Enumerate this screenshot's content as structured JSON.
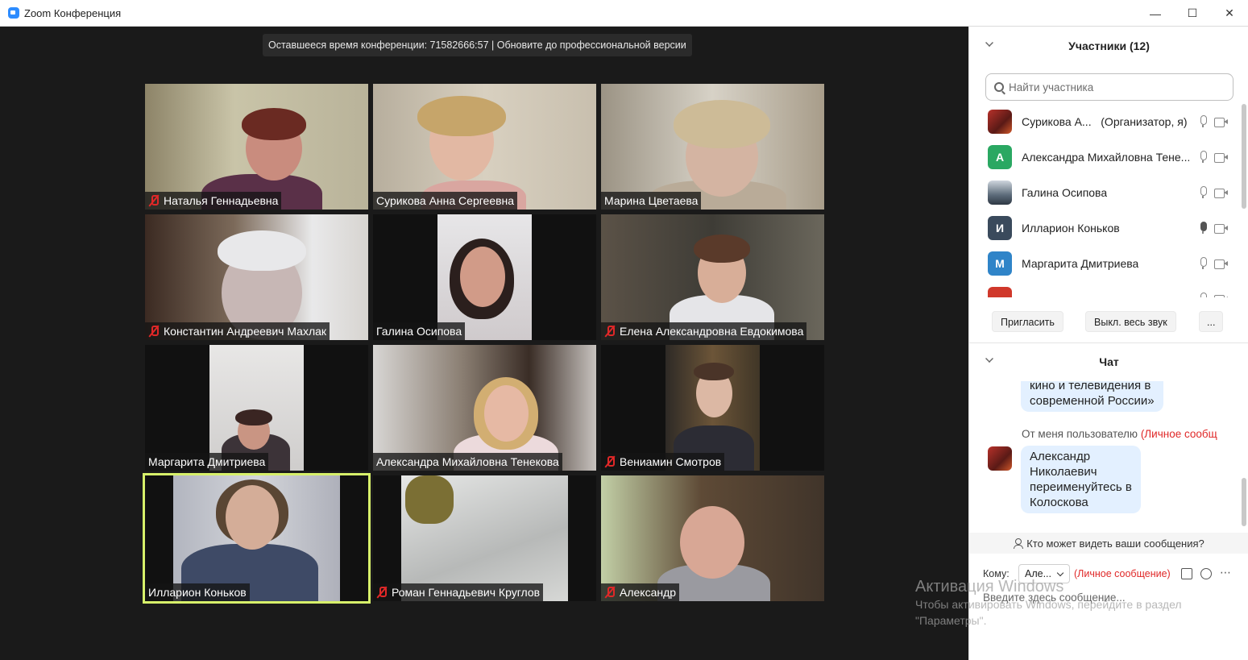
{
  "window": {
    "title": "Zoom Конференция",
    "controls": [
      "minimize",
      "maximize",
      "close"
    ]
  },
  "banner": "Оставшееся время конференции: 71582666:57 | Обновите до профессиональной версии",
  "tiles": [
    {
      "name": "Наталья Геннадьевна",
      "muted": true
    },
    {
      "name": "Сурикова Анна Сергеевна",
      "muted": false
    },
    {
      "name": "Марина Цветаева",
      "muted": false
    },
    {
      "name": "Константин Андреевич Махлак",
      "muted": true
    },
    {
      "name": "Галина Осипова",
      "muted": false
    },
    {
      "name": "Елена Александровна Евдокимова",
      "muted": true
    },
    {
      "name": "Маргарита Дмитриева",
      "muted": false
    },
    {
      "name": "Александра Михайловна Тенекова",
      "muted": false
    },
    {
      "name": "Вениамин Смотров",
      "muted": true
    },
    {
      "name": "Илларион Коньков",
      "muted": false,
      "active_speaker": true
    },
    {
      "name": "Роман Геннадьевич Круглов",
      "muted": true
    },
    {
      "name": "Александр",
      "muted": true
    }
  ],
  "participants_panel": {
    "title": "Участники (12)",
    "search_placeholder": "Найти участника",
    "list": [
      {
        "name": "Сурикова А...",
        "role": "(Организатор, я)",
        "avatar_letter": "",
        "avatar_color": "#b8312a"
      },
      {
        "name": "Александра Михайловна Тене...",
        "role": "",
        "avatar_letter": "А",
        "avatar_color": "#2aa862"
      },
      {
        "name": "Галина Осипова",
        "role": "",
        "avatar_letter": "",
        "avatar_color": "#6b7b8c"
      },
      {
        "name": "Илларион Коньков",
        "role": "",
        "avatar_letter": "И",
        "avatar_color": "#3a4a5c"
      },
      {
        "name": "Маргарита Дмитриева",
        "role": "",
        "avatar_letter": "М",
        "avatar_color": "#2f84c8"
      },
      {
        "name": "",
        "role": "",
        "avatar_letter": "",
        "avatar_color": "#d0382b"
      }
    ],
    "buttons": {
      "invite": "Пригласить",
      "mute_all": "Выкл. весь звук",
      "more": "..."
    }
  },
  "chat": {
    "title": "Чат",
    "messages": [
      {
        "text_lines": [
          "кино и телевидения в",
          "современной России»"
        ]
      },
      {
        "from": "От меня пользователю",
        "private_tag": "(Личное сообщ",
        "text_lines": [
          "Александр",
          "Николаевич",
          "переименуйтесь в",
          "Колоскова"
        ]
      }
    ],
    "who_can_see": "Кто может видеть ваши сообщения?",
    "to_label": "Кому:",
    "to_value": "Але...",
    "private_label": "(Личное сообщение)",
    "input_placeholder": "Введите здесь сообщение..."
  },
  "watermark": {
    "title": "Активация Windows",
    "line1": "Чтобы активировать Windows, перейдите в раздел",
    "line2": "\"Параметры\"."
  },
  "colors": {
    "accent": "#2d8cff",
    "active_speaker": "#d7f06a",
    "muted": "#e02828",
    "bubble": "#e3f0ff"
  }
}
